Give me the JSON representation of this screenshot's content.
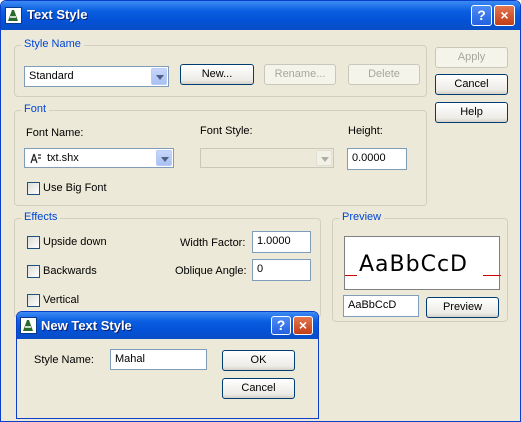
{
  "window": {
    "title": "Text Style",
    "help": "?",
    "close": "×"
  },
  "style_name": {
    "group_label": "Style Name",
    "selected": "Standard",
    "new_label": "New...",
    "rename_label": "Rename...",
    "delete_label": "Delete"
  },
  "side_buttons": {
    "apply": "Apply",
    "cancel": "Cancel",
    "help": "Help"
  },
  "font": {
    "group_label": "Font",
    "font_name_label": "Font Name:",
    "font_name_value": "txt.shx",
    "font_style_label": "Font Style:",
    "font_style_value": "",
    "height_label": "Height:",
    "height_value": "0.0000",
    "use_big_font_label": "Use Big Font"
  },
  "effects": {
    "group_label": "Effects",
    "upside_down_label": "Upside down",
    "backwards_label": "Backwards",
    "vertical_label": "Vertical",
    "width_factor_label": "Width Factor:",
    "width_factor_value": "1.0000",
    "oblique_angle_label": "Oblique Angle:",
    "oblique_angle_value": "0"
  },
  "preview": {
    "group_label": "Preview",
    "sample_text": "AaBbCcD",
    "preview_input_value": "AaBbCcD",
    "preview_button": "Preview"
  },
  "new_style_dialog": {
    "title": "New Text Style",
    "help": "?",
    "close": "×",
    "style_name_label": "Style Name:",
    "style_name_value": "Mahal",
    "ok_label": "OK",
    "cancel_label": "Cancel"
  },
  "colors": {
    "titlebar": "#0451d6",
    "group_label": "#0046d5",
    "window_bg": "#ece9d8",
    "preview_line": "#cc0000"
  }
}
